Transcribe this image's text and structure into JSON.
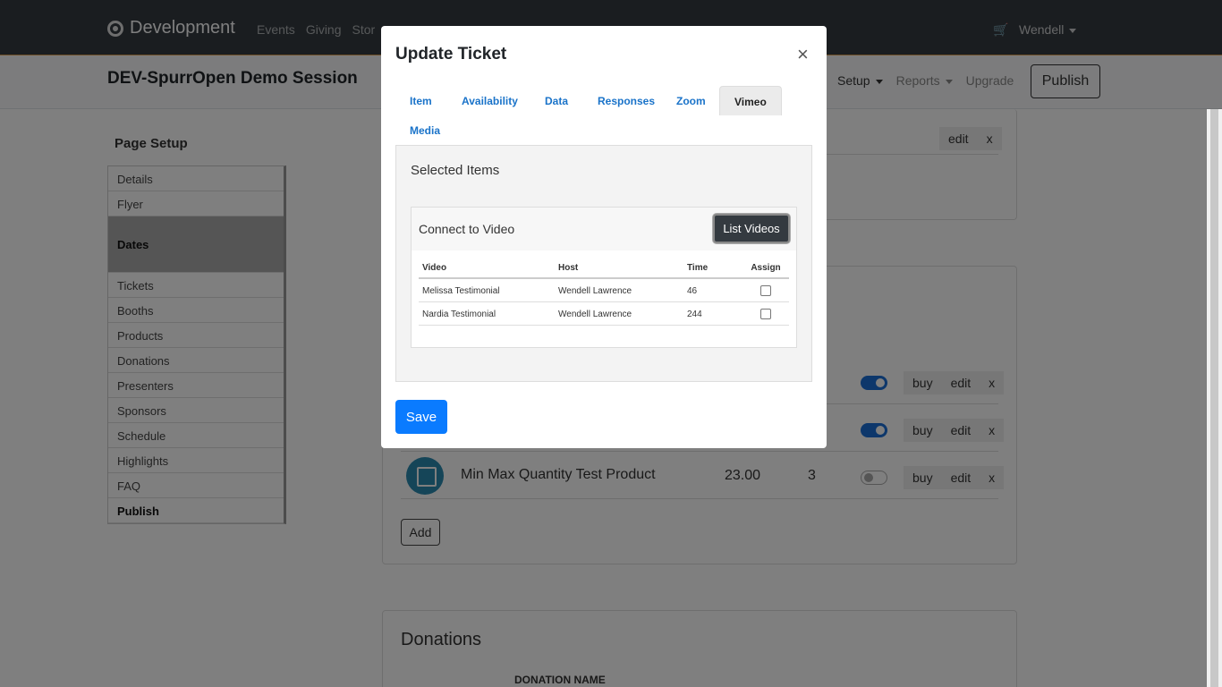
{
  "navbar": {
    "brand": "Development",
    "links": [
      "Events",
      "Giving",
      "Stor"
    ],
    "user": "Wendell"
  },
  "subbar": {
    "event_title": "DEV-SpurrOpen Demo Session",
    "links": [
      "Setup",
      "Reports",
      "Upgrade"
    ],
    "publish_label": "Publish"
  },
  "sidebar": {
    "title": "Page Setup",
    "items": [
      "Details",
      "Flyer",
      "Dates",
      "Tickets",
      "Booths",
      "Products",
      "Donations",
      "Presenters",
      "Sponsors",
      "Schedule",
      "Highlights",
      "FAQ",
      "Publish"
    ],
    "active": "Dates"
  },
  "background": {
    "product_name": "Min Max Quantity Test Product",
    "product_price": "23.00",
    "product_qty": "3",
    "actions": {
      "buy": "buy",
      "edit": "edit",
      "remove": "x"
    },
    "add_label": "Add",
    "donations_title": "Donations",
    "donation_column": "DONATION NAME"
  },
  "modal": {
    "title": "Update Ticket",
    "close_label": "×",
    "tabs": [
      "Item",
      "Availability",
      "Data",
      "Responses",
      "Zoom",
      "Vimeo",
      "Media"
    ],
    "active_tab": "Vimeo",
    "panel_title": "Selected Items",
    "connect_label": "Connect to Video",
    "list_videos_label": "List Videos",
    "table": {
      "headers": [
        "Video",
        "Host",
        "Time",
        "Assign"
      ],
      "rows": [
        {
          "video": "Melissa Testimonial",
          "host": "Wendell Lawrence",
          "time": "46",
          "assigned": false
        },
        {
          "video": "Nardia Testimonial",
          "host": "Wendell Lawrence",
          "time": "244",
          "assigned": false
        }
      ]
    },
    "save_label": "Save"
  }
}
